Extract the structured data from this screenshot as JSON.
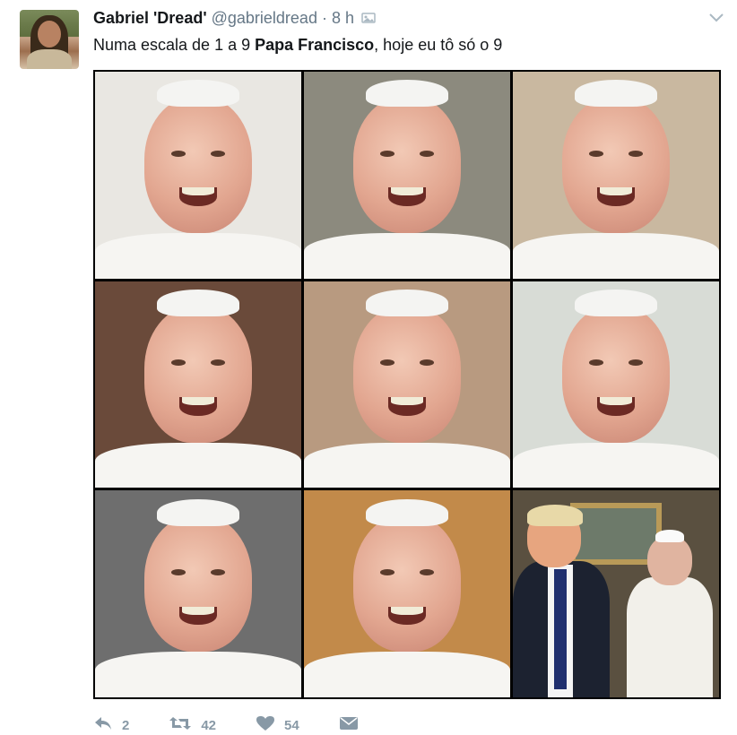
{
  "tweet": {
    "author_name": "Gabriel 'Dread'",
    "handle": "@gabrieldread",
    "separator": "·",
    "time": "8 h",
    "text_before": "Numa escala de 1 a 9 ",
    "text_bold": "Papa Francisco",
    "text_after": ", hoje eu tô só o 9"
  },
  "media": {
    "tiles": [
      {
        "bg": "#e9e7e2"
      },
      {
        "bg": "#8c8a7e"
      },
      {
        "bg": "#c9b8a0"
      },
      {
        "bg": "#6a4a3a"
      },
      {
        "bg": "#b89a80"
      },
      {
        "bg": "#d8dcd6"
      },
      {
        "bg": "#6e6e6e"
      },
      {
        "bg": "#c28a4a"
      },
      {
        "bg": "#5a5040"
      }
    ]
  },
  "actions": {
    "reply_count": "2",
    "retweet_count": "42",
    "like_count": "54"
  },
  "colors": {
    "text": "#14171a",
    "muted": "#657786",
    "action": "#8899a6"
  }
}
